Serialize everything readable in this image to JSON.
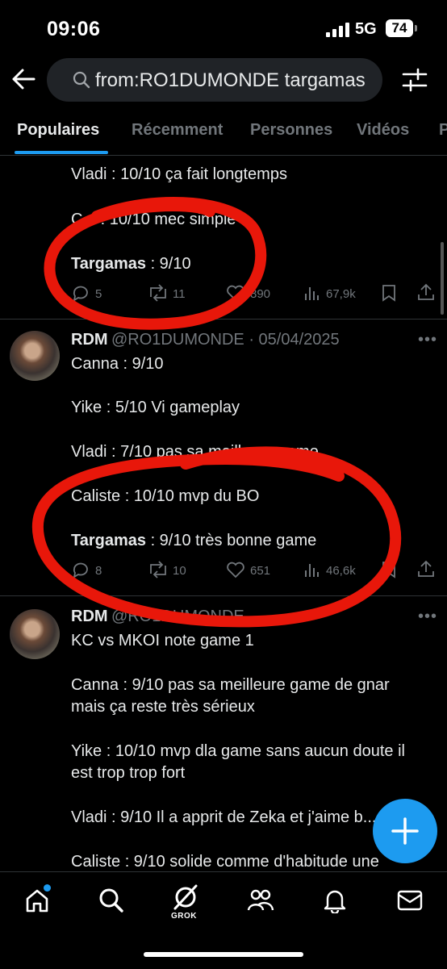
{
  "status_bar": {
    "time": "09:06",
    "network": "5G",
    "battery": "74"
  },
  "search": {
    "query": "from:RO1DUMONDE targamas"
  },
  "tabs": [
    {
      "label": "Populaires"
    },
    {
      "label": "Récemment"
    },
    {
      "label": "Personnes"
    },
    {
      "label": "Vidéos"
    },
    {
      "label": "P"
    }
  ],
  "tweet1": {
    "lines": [
      "Vladi : 10/10 ça fait longtemps",
      "C... : 10/10 mec simple"
    ],
    "targamas_name": "Targamas",
    "targamas_rest": " : 9/10",
    "replies": "5",
    "reposts": "11",
    "likes": "890",
    "views": "67,9k"
  },
  "tweet2": {
    "author": "RDM",
    "handle_date": "@RO1DUMONDE · 05/04/2025",
    "lines": [
      "Canna : 9/10",
      "Yike : 5/10 Vi gameplay",
      "Vladi : 7/10 pas sa meilleure game",
      "Caliste : 10/10 mvp du BO"
    ],
    "targamas_name": "Targamas",
    "targamas_rest": " : 9/10 très bonne game",
    "replies": "8",
    "reposts": "10",
    "likes": "651",
    "views": "46,6k"
  },
  "tweet3": {
    "author": "RDM",
    "handle": "@RO1DUMONDE",
    "lines": [
      "KC vs MKOI note game 1",
      "Canna : 9/10 pas sa meilleure game de gnar",
      "mais ça reste très sérieux",
      "Yike : 10/10 mvp dla game sans aucun doute il",
      "est trop trop fort",
      "Vladi : 9/10 Il a apprit de Zeka et j'aime b...",
      "Caliste : 9/10 solide comme d'habitude une"
    ]
  },
  "bottom_nav": {
    "grok_label": "GROK"
  },
  "colors": {
    "accent": "#1d9bf0",
    "annotation": "#e8170a"
  }
}
